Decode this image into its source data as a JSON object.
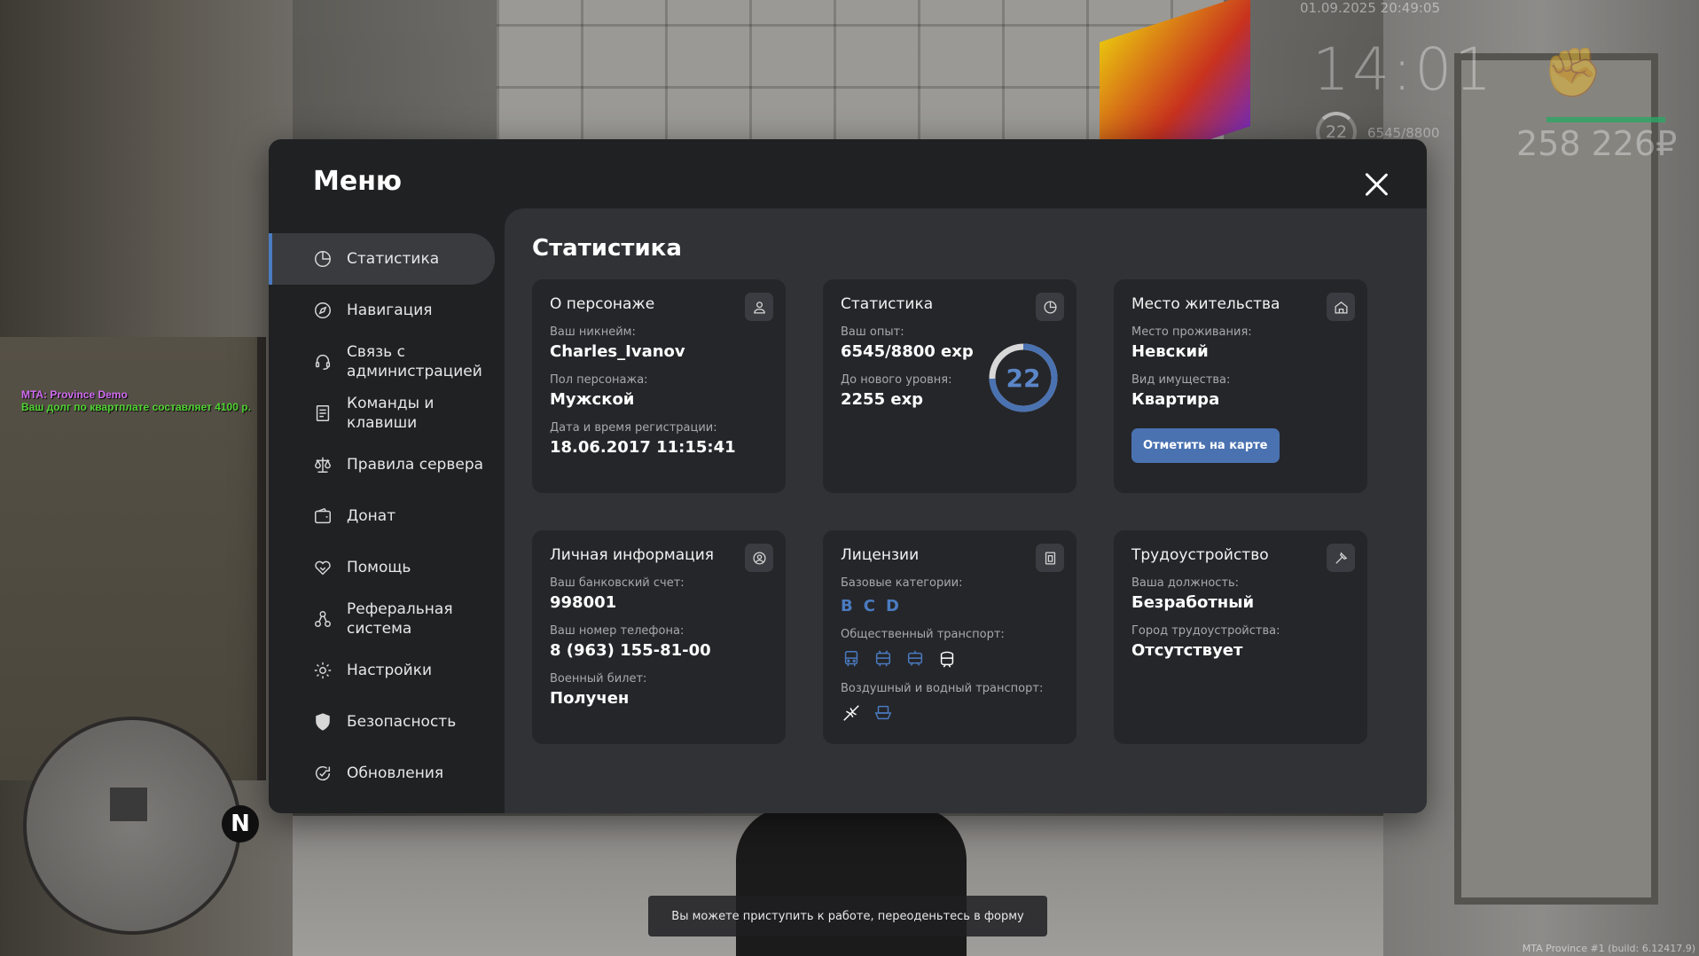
{
  "hud": {
    "datetime": "01.09.2025 20:49:05",
    "time": "14:01",
    "level": "22",
    "exp": "6545/8800",
    "money": "258 226₽"
  },
  "chat": {
    "line1": "MTA: Province Demo",
    "line2": "Ваш долг по квартплате составляет 4100 р."
  },
  "minimap": {
    "north": "N"
  },
  "notice": "Вы можете приступить к работе, переоденьтесь в форму",
  "build": "MTA Province #1 (build: 6.12417.9)",
  "menu": {
    "title": "Меню",
    "sidebar": [
      {
        "label": "Статистика",
        "icon": "statistics-icon",
        "active": true
      },
      {
        "label": "Навигация",
        "icon": "compass-icon"
      },
      {
        "label": "Связь с администрацией",
        "icon": "headset-icon"
      },
      {
        "label": "Команды и клавиши",
        "icon": "document-icon"
      },
      {
        "label": "Правила сервера",
        "icon": "scales-icon"
      },
      {
        "label": "Донат",
        "icon": "wallet-icon"
      },
      {
        "label": "Помощь",
        "icon": "handshake-icon"
      },
      {
        "label": "Реферальная система",
        "icon": "referral-icon"
      },
      {
        "label": "Настройки",
        "icon": "gear-icon"
      },
      {
        "label": "Безопасность",
        "icon": "shield-icon"
      },
      {
        "label": "Обновления",
        "icon": "refresh-icon"
      }
    ]
  },
  "content": {
    "title": "Статистика",
    "character": {
      "title": "О персонаже",
      "nick_label": "Ваш никнейм:",
      "nick": "Charles_Ivanov",
      "gender_label": "Пол персонажа:",
      "gender": "Мужской",
      "reg_label": "Дата и время регистрации:",
      "reg": "18.06.2017 11:15:41"
    },
    "stats": {
      "title": "Статистика",
      "exp_label": "Ваш опыт:",
      "exp": "6545/8800 exp",
      "next_label": "До нового уровня:",
      "next": "2255 exp",
      "level": "22",
      "exp_progress": 0.744
    },
    "residence": {
      "title": "Место жительства",
      "place_label": "Место проживания:",
      "place": "Невский",
      "type_label": "Вид имущества:",
      "type": "Квартира",
      "button": "Отметить на карте"
    },
    "personal": {
      "title": "Личная информация",
      "bank_label": "Ваш банковский счет:",
      "bank": "998001",
      "phone_label": "Ваш номер телефона:",
      "phone": "8 (963) 155-81-00",
      "military_label": "Военный билет:",
      "military": "Получен"
    },
    "licenses": {
      "title": "Лицензии",
      "base_label": "Базовые категории:",
      "base": [
        "B",
        "C",
        "D"
      ],
      "public_label": "Общественный транспорт:",
      "air_label": "Воздушный и водный транспорт:"
    },
    "job": {
      "title": "Трудоустройство",
      "position_label": "Ваша должность:",
      "position": "Безработный",
      "city_label": "Город трудоустройства:",
      "city": "Отсутствует"
    }
  },
  "colors": {
    "accent": "#4a7bc0",
    "panel": "#202123",
    "content": "#313236",
    "card": "#25262a"
  }
}
